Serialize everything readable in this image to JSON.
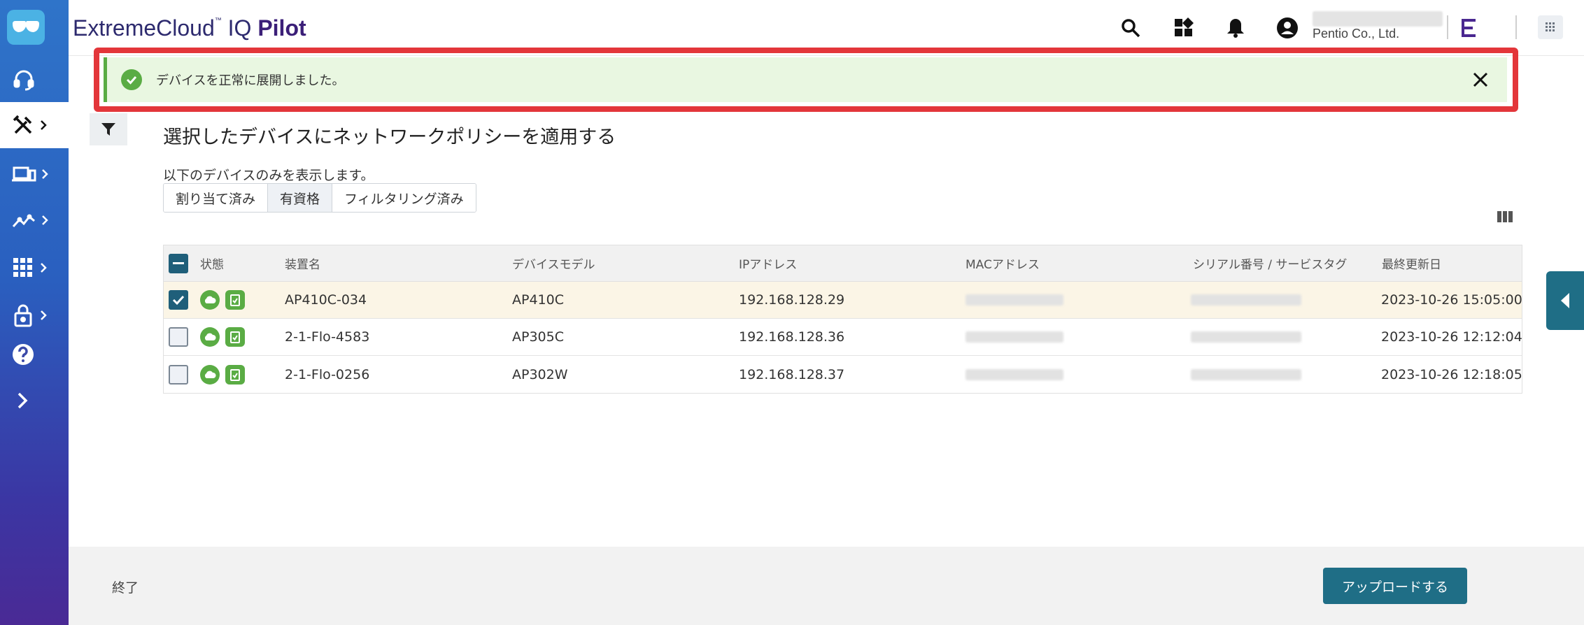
{
  "header": {
    "brand_main": "ExtremeCloud",
    "brand_tm": "™",
    "brand_iq": " IQ ",
    "brand_pilot": "Pilot",
    "org_name": "Pentio Co., Ltd."
  },
  "alert": {
    "message": "デバイスを正常に展開しました。",
    "outline_color": "#e3363a",
    "success_color": "#5aac44"
  },
  "page": {
    "title": "選択したデバイスにネットワークポリシーを適用する",
    "filter_note": "以下のデバイスのみを表示します。",
    "segments": [
      "割り当て済み",
      "有資格",
      "フィルタリング済み"
    ],
    "selected_segment": "有資格"
  },
  "table": {
    "headers": {
      "status": "状態",
      "name": "装置名",
      "model": "デバイスモデル",
      "ip": "IPアドレス",
      "mac": "MACアドレス",
      "serial": "シリアル番号 / サービスタグ",
      "updated": "最終更新日"
    },
    "rows": [
      {
        "name": "AP410C-034",
        "model": "AP410C",
        "ip": "192.168.128.29",
        "updated": "2023-10-26 15:05:00",
        "checked": true
      },
      {
        "name": "2-1-Flo-4583",
        "model": "AP305C",
        "ip": "192.168.128.36",
        "updated": "2023-10-26 12:12:04",
        "checked": false
      },
      {
        "name": "2-1-Flo-0256",
        "model": "AP302W",
        "ip": "192.168.128.37",
        "updated": "2023-10-26 12:18:05",
        "checked": false
      }
    ]
  },
  "footer": {
    "exit_label": "終了",
    "upload_label": "アップロードする"
  },
  "colors": {
    "sidebar_top": "#2f74c9",
    "sidebar_bottom": "#4a2a95",
    "primary_button": "#1f6e86"
  }
}
